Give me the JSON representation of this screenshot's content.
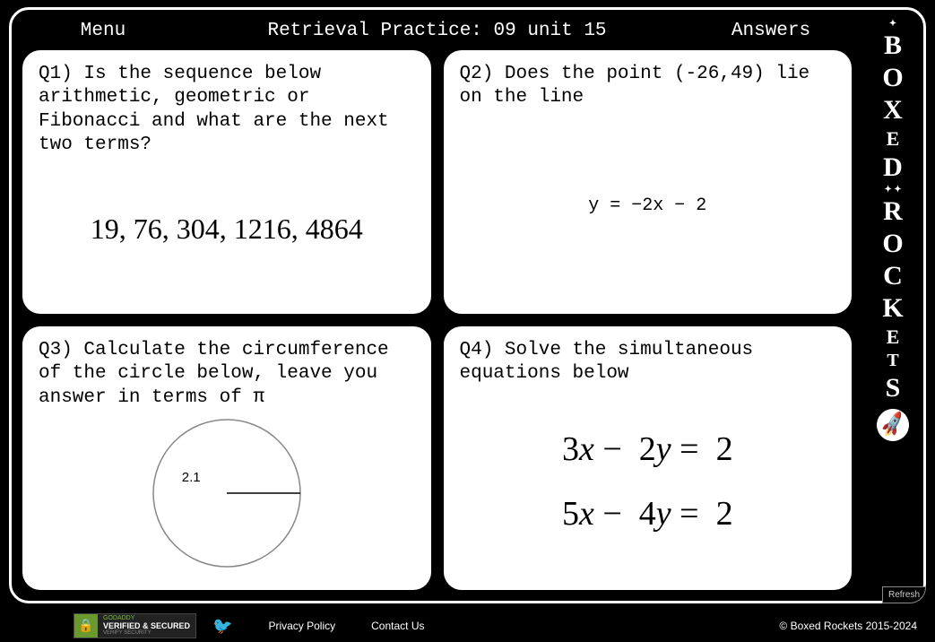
{
  "header": {
    "menu": "Menu",
    "title": "Retrieval Practice: 09 unit 15",
    "answers": "Answers"
  },
  "questions": {
    "q1": {
      "prompt": "Q1) Is the sequence below arithmetic, geometric or Fibonacci and what are the next two terms?",
      "sequence": "19, 76, 304, 1216, 4864"
    },
    "q2": {
      "prompt": "Q2) Does the point (-26,49) lie on the line",
      "equation": "y = −2x − 2"
    },
    "q3": {
      "prompt": "Q3) Calculate the circumference of the circle below, leave you answer in terms of π",
      "radius": "2.1"
    },
    "q4": {
      "prompt": "Q4) Solve the simultaneous equations below",
      "eq1": {
        "a": "3",
        "b": "2",
        "c": "2"
      },
      "eq2": {
        "a": "5",
        "b": "4",
        "c": "2"
      }
    }
  },
  "sidebar": {
    "brand_top": "BOXED",
    "brand_bottom": "ROCKETS",
    "refresh": "Refresh"
  },
  "footer": {
    "badge_line1": "GODADDY",
    "badge_line2": "VERIFIED & SECURED",
    "badge_line3": "VERIFY SECURITY",
    "privacy": "Privacy Policy",
    "contact": "Contact Us",
    "copyright": "© Boxed Rockets 2015-2024"
  }
}
